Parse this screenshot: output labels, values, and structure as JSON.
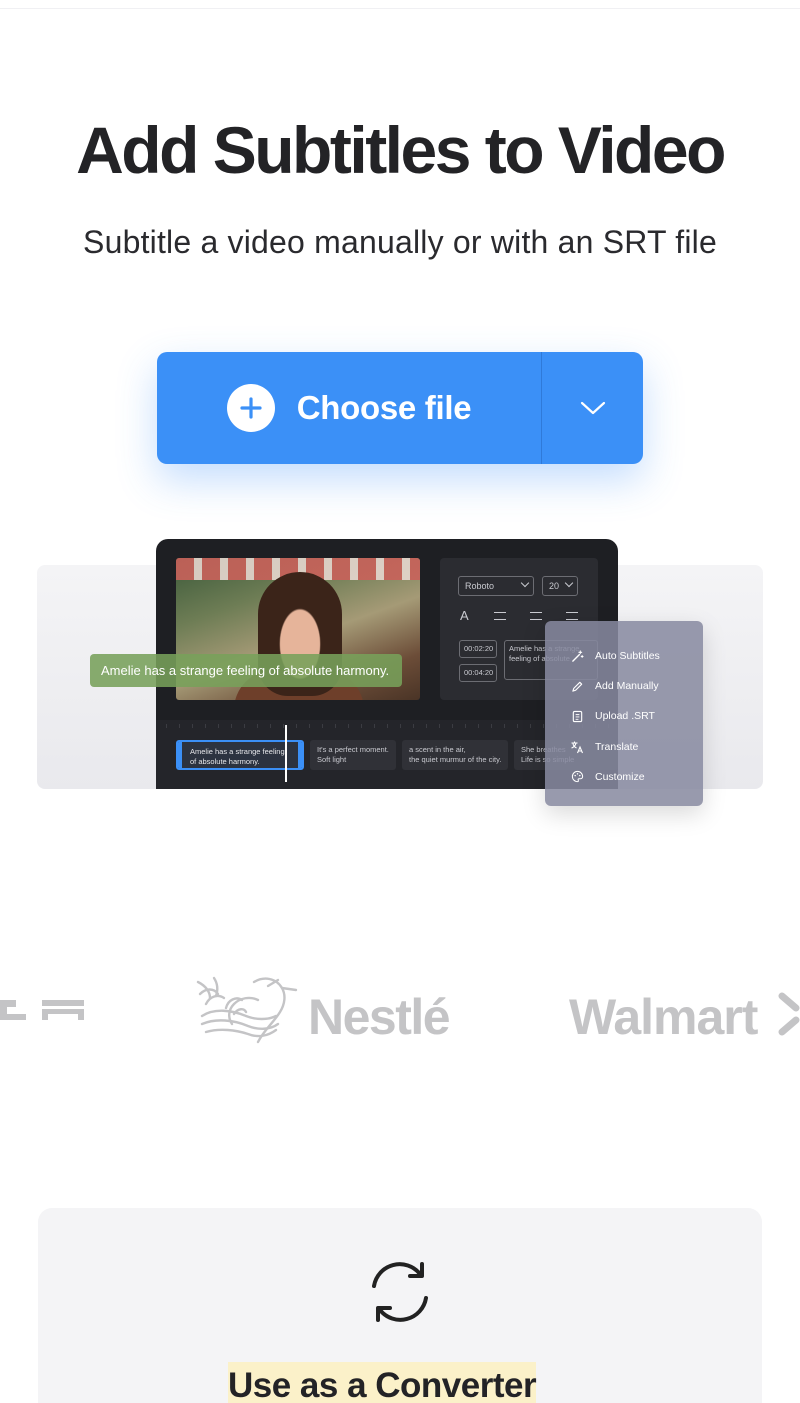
{
  "page": {
    "title": "Add Subtitles to Video",
    "subtitle": "Subtitle a video manually or with an SRT file"
  },
  "cta": {
    "label": "Choose file",
    "accent": "#3b90f7"
  },
  "preview": {
    "caption": "Amelie has a strange feeling of absolute harmony.",
    "font_select": "Roboto",
    "size_select": "20",
    "times": [
      "00:02:20",
      "00:04:20"
    ],
    "text_box": "Amelie has a strange feeling of absolute",
    "clips": [
      {
        "line1": "Amelie has a strange feeling",
        "line2": "of absolute harmony."
      },
      {
        "line1": "It's a perfect moment.",
        "line2": "Soft light"
      },
      {
        "line1": "a scent in the air,",
        "line2": "the quiet murmur of the city."
      },
      {
        "line1": "She breathes",
        "line2": "Life is so simple"
      }
    ],
    "menu": [
      {
        "label": "Auto Subtitles",
        "icon": "magic-wand-icon"
      },
      {
        "label": "Add Manually",
        "icon": "pencil-icon"
      },
      {
        "label": "Upload .SRT",
        "icon": "document-icon"
      },
      {
        "label": "Translate",
        "icon": "translate-icon"
      },
      {
        "label": "Customize",
        "icon": "palette-icon"
      }
    ]
  },
  "logos": {
    "tesla": "TESLA",
    "nestle": "Nestlé",
    "walmart": "Walmart"
  },
  "converter": {
    "title": "Use as a Converter",
    "icon": "refresh-icon"
  }
}
